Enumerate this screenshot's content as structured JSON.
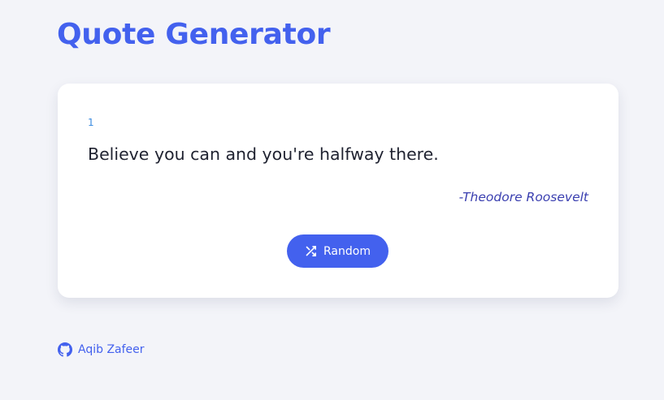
{
  "header": {
    "title": "Quote Generator"
  },
  "quote_card": {
    "number": "1",
    "text": "Believe you can and you're halfway there.",
    "author": "-Theodore Roosevelt",
    "random_button": {
      "label": "Random",
      "icon": "shuffle-icon"
    }
  },
  "footer": {
    "author_name": "Aqib Zafeer",
    "icon": "github-icon"
  },
  "colors": {
    "accent": "#4361ee",
    "background": "#f3f4f9",
    "card": "#ffffff",
    "author_text": "#3a3fb0",
    "number_text": "#3b8be0"
  }
}
